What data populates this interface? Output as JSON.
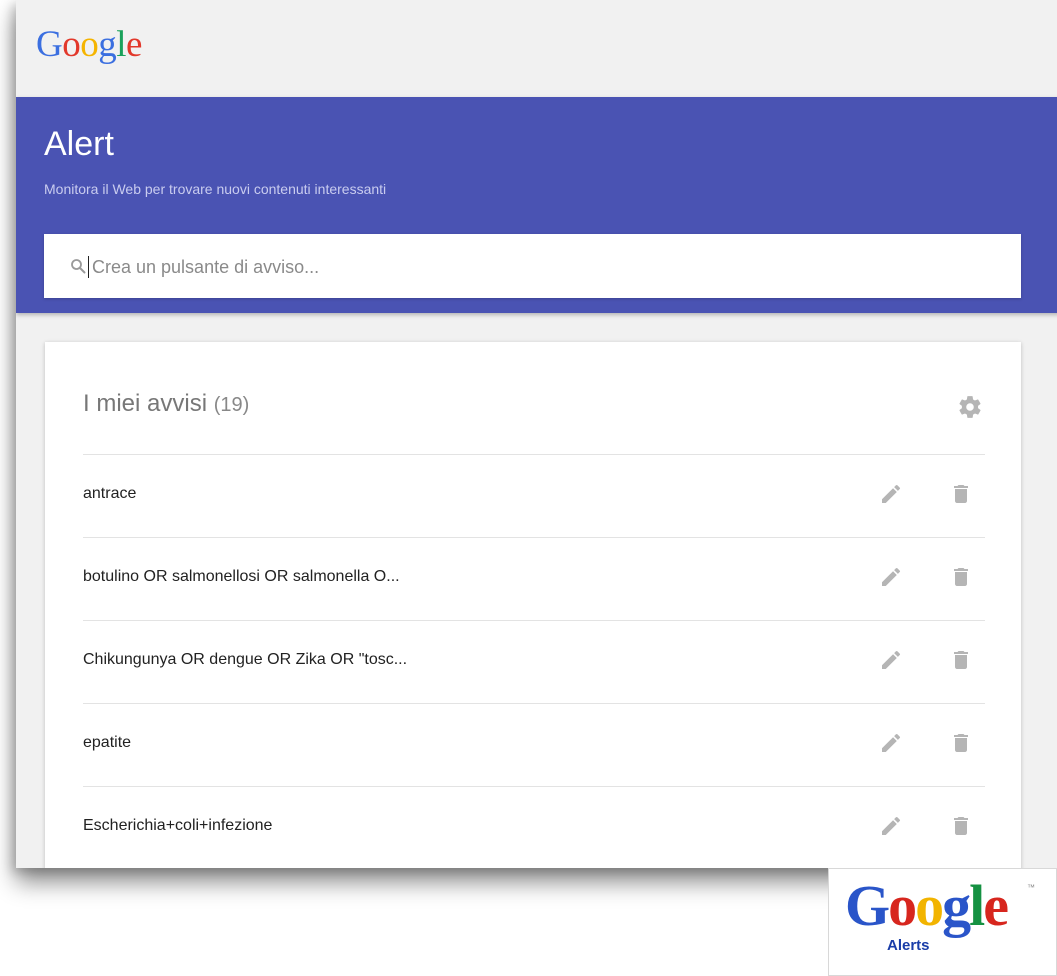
{
  "header": {
    "logo_letters": [
      "G",
      "o",
      "o",
      "g",
      "l",
      "e"
    ],
    "logo_colors": [
      "#3b6fe0",
      "#e2382b",
      "#f5b400",
      "#3b6fe0",
      "#1aa15b",
      "#e2382b"
    ]
  },
  "hero": {
    "title": "Alert",
    "subtitle": "Monitora il Web per trovare nuovi contenuti interessanti"
  },
  "search": {
    "placeholder": "Crea un pulsante di avviso...",
    "value": "",
    "icon": "search-icon"
  },
  "alerts": {
    "title": "I miei avvisi",
    "count": "(19)",
    "settings_icon": "gear-icon",
    "items": [
      {
        "label": "antrace"
      },
      {
        "label": "botulino OR salmonellosi OR salmonella O..."
      },
      {
        "label": "Chikungunya OR dengue OR Zika OR \"tosc..."
      },
      {
        "label": "epatite"
      },
      {
        "label": "Escherichia+coli+infezione"
      }
    ],
    "edit_icon": "pencil-icon",
    "delete_icon": "trash-icon"
  },
  "badge": {
    "letters": [
      "G",
      "o",
      "o",
      "g",
      "l",
      "e"
    ],
    "colors": [
      "#2a55c9",
      "#d7261e",
      "#f2b400",
      "#2a55c9",
      "#159142",
      "#d7261e"
    ],
    "tm": "™",
    "sub": "Alerts"
  },
  "colors": {
    "hero": "#4a53b3",
    "icon_gray": "#b5b5b5"
  }
}
